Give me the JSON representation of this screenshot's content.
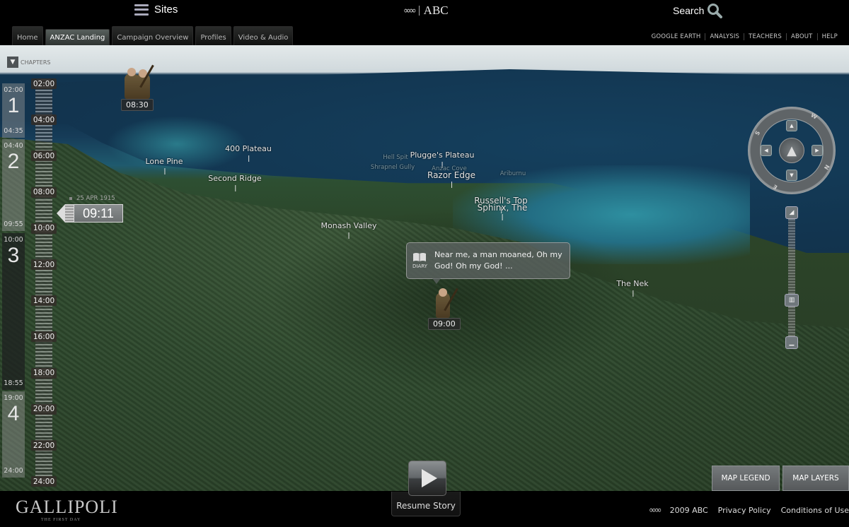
{
  "header": {
    "sites_label": "Sites",
    "logo_text": "ABC",
    "search_label": "Search",
    "tabs": [
      {
        "label": "Home",
        "active": false
      },
      {
        "label": "ANZAC Landing",
        "active": true
      },
      {
        "label": "Campaign Overview",
        "active": false
      },
      {
        "label": "Profiles",
        "active": false
      },
      {
        "label": "Video & Audio",
        "active": false
      }
    ],
    "util_links": [
      "GOOGLE EARTH",
      "ANALYSIS",
      "TEACHERS",
      "ABOUT",
      "HELP"
    ]
  },
  "map": {
    "chapters_label": "CHAPTERS",
    "chapters": [
      {
        "number": "1",
        "start": "02:00",
        "end": "04:35"
      },
      {
        "number": "2",
        "start": "04:40",
        "end": "09:55"
      },
      {
        "number": "3",
        "start": "10:00",
        "end": "18:55"
      },
      {
        "number": "4",
        "start": "19:00",
        "end": "24:00"
      }
    ],
    "timeline_hours": [
      "02:00",
      "04:00",
      "06:00",
      "08:00",
      "10:00",
      "12:00",
      "14:00",
      "16:00",
      "18:00",
      "20:00",
      "22:00",
      "24:00"
    ],
    "current_date": "25 APR 1915",
    "current_time": "09:11",
    "places": [
      {
        "name": "Lone Pine",
        "type": "major"
      },
      {
        "name": "400 Plateau",
        "type": "major"
      },
      {
        "name": "Second Ridge",
        "type": "major"
      },
      {
        "name": "Plugge's Plateau",
        "type": "major"
      },
      {
        "name": "Hell Spit",
        "type": "minor"
      },
      {
        "name": "Shrapnel Gully",
        "type": "minor"
      },
      {
        "name": "Anzac Cove",
        "type": "minor"
      },
      {
        "name": "Razor Edge",
        "type": "major"
      },
      {
        "name": "Ariburnu",
        "type": "minor"
      },
      {
        "name": "Russell's Top",
        "type": "major"
      },
      {
        "name": "Sphinx, The",
        "type": "major"
      },
      {
        "name": "Monash Valley",
        "type": "major"
      },
      {
        "name": "The Nek",
        "type": "major"
      }
    ],
    "characters": [
      {
        "time": "08:30"
      },
      {
        "time": "09:00"
      }
    ],
    "diary": {
      "icon_label": "DIARY",
      "text": "Near me, a man moaned, Oh my God! Oh my God! ..."
    },
    "compass": {
      "directions": [
        "W",
        "S",
        "N",
        "E"
      ]
    },
    "buttons": {
      "map_legend": "MAP LEGEND",
      "map_layers": "MAP LAYERS"
    }
  },
  "player": {
    "resume_label": "Resume Story"
  },
  "footer": {
    "brand": "GALLIPOLI",
    "brand_sub": "THE FIRST DAY",
    "copyright": "2009 ABC",
    "privacy": "Privacy Policy",
    "conditions": "Conditions of Use"
  }
}
